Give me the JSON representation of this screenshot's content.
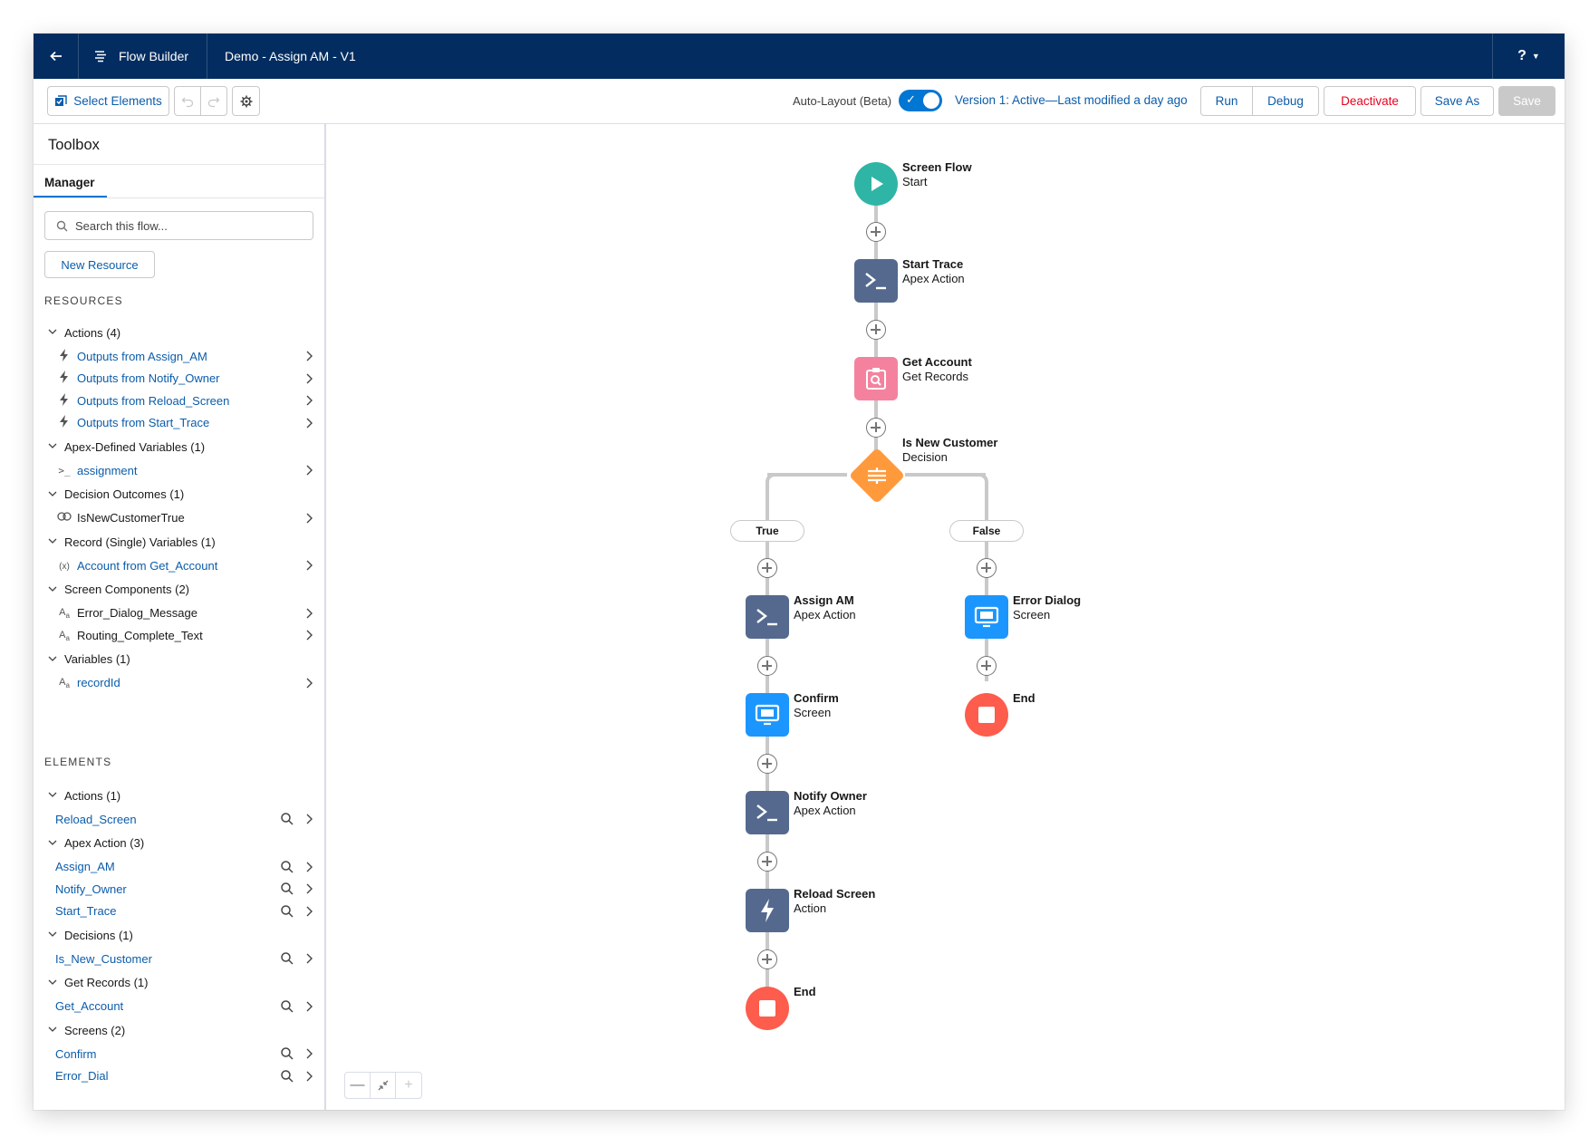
{
  "header": {
    "app_name": "Flow Builder",
    "flow_name": "Demo - Assign AM - V1",
    "help_label": "?"
  },
  "toolbar": {
    "select_elements": "Select Elements",
    "auto_layout_label": "Auto-Layout (Beta)",
    "auto_layout_on": true,
    "version_text": "Version 1: Active—Last modified a day ago",
    "run": "Run",
    "debug": "Debug",
    "deactivate": "Deactivate",
    "save_as": "Save As",
    "save": "Save"
  },
  "sidebar": {
    "title": "Toolbox",
    "tab": "Manager",
    "search_placeholder": "Search this flow...",
    "new_resource": "New Resource",
    "resources_header": "RESOURCES",
    "elements_header": "ELEMENTS",
    "resources": [
      {
        "label": "Actions (4)",
        "items": [
          {
            "icon": "lightning-icon",
            "label": "Outputs from Assign_AM"
          },
          {
            "icon": "lightning-icon",
            "label": "Outputs from Notify_Owner"
          },
          {
            "icon": "lightning-icon",
            "label": "Outputs from Reload_Screen"
          },
          {
            "icon": "lightning-icon",
            "label": "Outputs from Start_Trace"
          }
        ]
      },
      {
        "label": "Apex-Defined Variables (1)",
        "items": [
          {
            "icon": "apex-icon",
            "label": "assignment"
          }
        ]
      },
      {
        "label": "Decision Outcomes (1)",
        "items": [
          {
            "icon": "outcome-icon",
            "label": "IsNewCustomerTrue"
          }
        ]
      },
      {
        "label": "Record (Single) Variables (1)",
        "items": [
          {
            "icon": "variable-icon",
            "label": "Account from Get_Account"
          }
        ]
      },
      {
        "label": "Screen Components (2)",
        "items": [
          {
            "icon": "text-icon",
            "label": "Error_Dialog_Message"
          },
          {
            "icon": "text-icon",
            "label": "Routing_Complete_Text"
          }
        ]
      },
      {
        "label": "Variables (1)",
        "items": [
          {
            "icon": "text-icon",
            "label": "recordId"
          }
        ]
      }
    ],
    "elements": [
      {
        "label": "Actions (1)",
        "items": [
          "Reload_Screen"
        ]
      },
      {
        "label": "Apex Action (3)",
        "items": [
          "Assign_AM",
          "Notify_Owner",
          "Start_Trace"
        ]
      },
      {
        "label": "Decisions (1)",
        "items": [
          "Is_New_Customer"
        ]
      },
      {
        "label": "Get Records (1)",
        "items": [
          "Get_Account"
        ]
      },
      {
        "label": "Screens (2)",
        "items": [
          "Confirm",
          "Error_Dial"
        ]
      }
    ]
  },
  "canvas": {
    "colors": {
      "start": "#3ba755",
      "apex": "#54698d",
      "get_records": "#f4829e",
      "decision": "#ff9a3c",
      "screen": "#1b96ff",
      "end": "#ea001e"
    },
    "nodes": {
      "start": {
        "title": "Screen Flow",
        "subtitle": "Start"
      },
      "start_trace": {
        "title": "Start Trace",
        "subtitle": "Apex Action"
      },
      "get_account": {
        "title": "Get Account",
        "subtitle": "Get Records"
      },
      "decision": {
        "title": "Is New Customer",
        "subtitle": "Decision"
      },
      "assign_am": {
        "title": "Assign AM",
        "subtitle": "Apex Action"
      },
      "confirm": {
        "title": "Confirm",
        "subtitle": "Screen"
      },
      "notify_owner": {
        "title": "Notify Owner",
        "subtitle": "Apex Action"
      },
      "reload_screen": {
        "title": "Reload Screen",
        "subtitle": "Action"
      },
      "end_true": {
        "title": "End"
      },
      "error_dialog": {
        "title": "Error Dialog",
        "subtitle": "Screen"
      },
      "end_false": {
        "title": "End"
      }
    },
    "branches": {
      "true_label": "True",
      "false_label": "False"
    }
  }
}
